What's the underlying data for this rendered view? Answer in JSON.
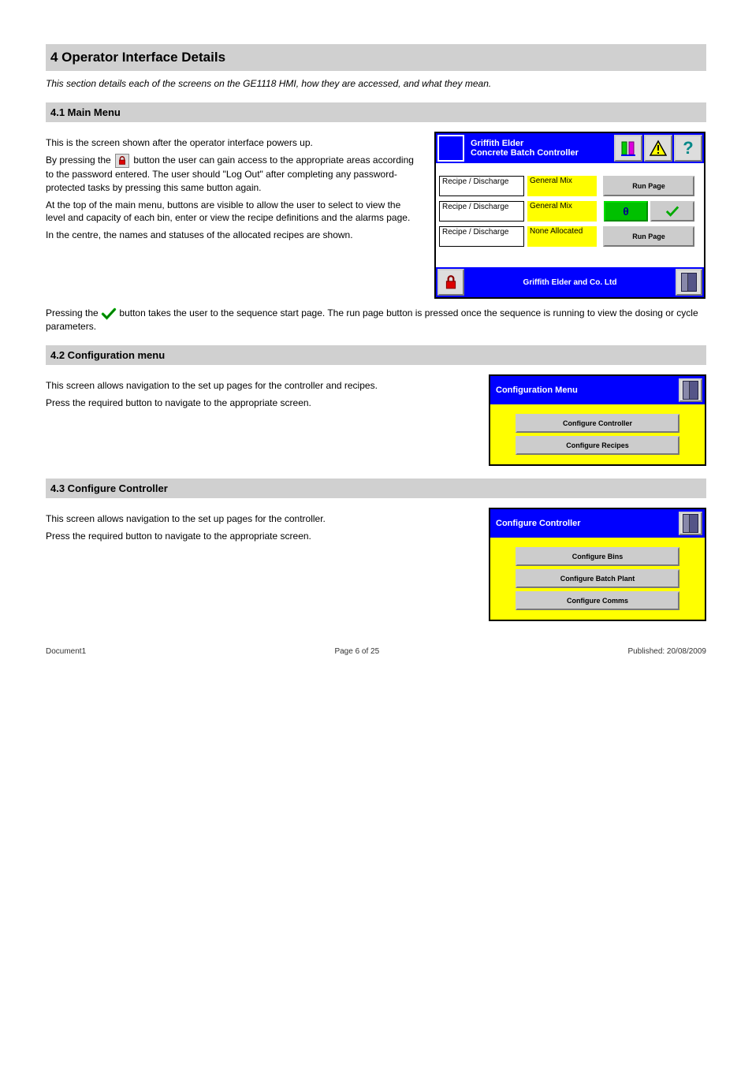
{
  "section4": {
    "title": "4 Operator Interface Details",
    "s41": {
      "title": "4.1 Main Menu",
      "intro": "This is the screen shown after the operator interface powers up.",
      "p1a": "By pressing the ",
      "p1b": " button the user can gain access to the appropriate areas according to the password entered. The user should \"Log Out\" after completing any password-protected tasks by pressing this same button again.",
      "p2": "At the top of the main menu, buttons are visible to allow the user to select to view the level and capacity of each bin, enter or view the recipe definitions and the alarms page.",
      "p3": "In the centre, the names and statuses of the allocated recipes are shown.",
      "p4a": "Pressing the ",
      "p4b": " button takes the user to the sequence start page. The run page button is pressed once the sequence is running to view the dosing or cycle parameters."
    },
    "s42": {
      "title": "4.2 Configuration menu",
      "p1": "This screen allows navigation to the set up pages for the controller and recipes.",
      "p2": "Press the required button to navigate to the appropriate screen."
    },
    "s43": {
      "title": "4.3 Configure Controller",
      "p1": "This screen allows navigation to the set up pages for the controller.",
      "p2": "Press the required button to navigate to the appropriate screen."
    }
  },
  "mainMenu": {
    "titleLine1": "Griffith Elder",
    "titleLine2": "Concrete Batch Controller",
    "rows": [
      {
        "label": "Recipe / Discharge",
        "value": "General Mix",
        "btnLabel": "Run Page"
      },
      {
        "label": "Recipe / Discharge",
        "value": "General Mix",
        "confirmGlyph": "θ"
      },
      {
        "label": "Recipe / Discharge",
        "value": "None Allocated",
        "btnLabel": "Run Page"
      }
    ],
    "footerText": "Griffith Elder and Co. Ltd"
  },
  "configMenu": {
    "title": "Configuration Menu",
    "buttons": [
      "Configure Controller",
      "Configure Recipes"
    ]
  },
  "configController": {
    "title": "Configure Controller",
    "buttons": [
      "Configure Bins",
      "Configure Batch Plant",
      "Configure Comms"
    ]
  },
  "footer": {
    "left": "Document1",
    "centre": "Page 6 of 25",
    "right": "Published: 20/08/2009"
  }
}
